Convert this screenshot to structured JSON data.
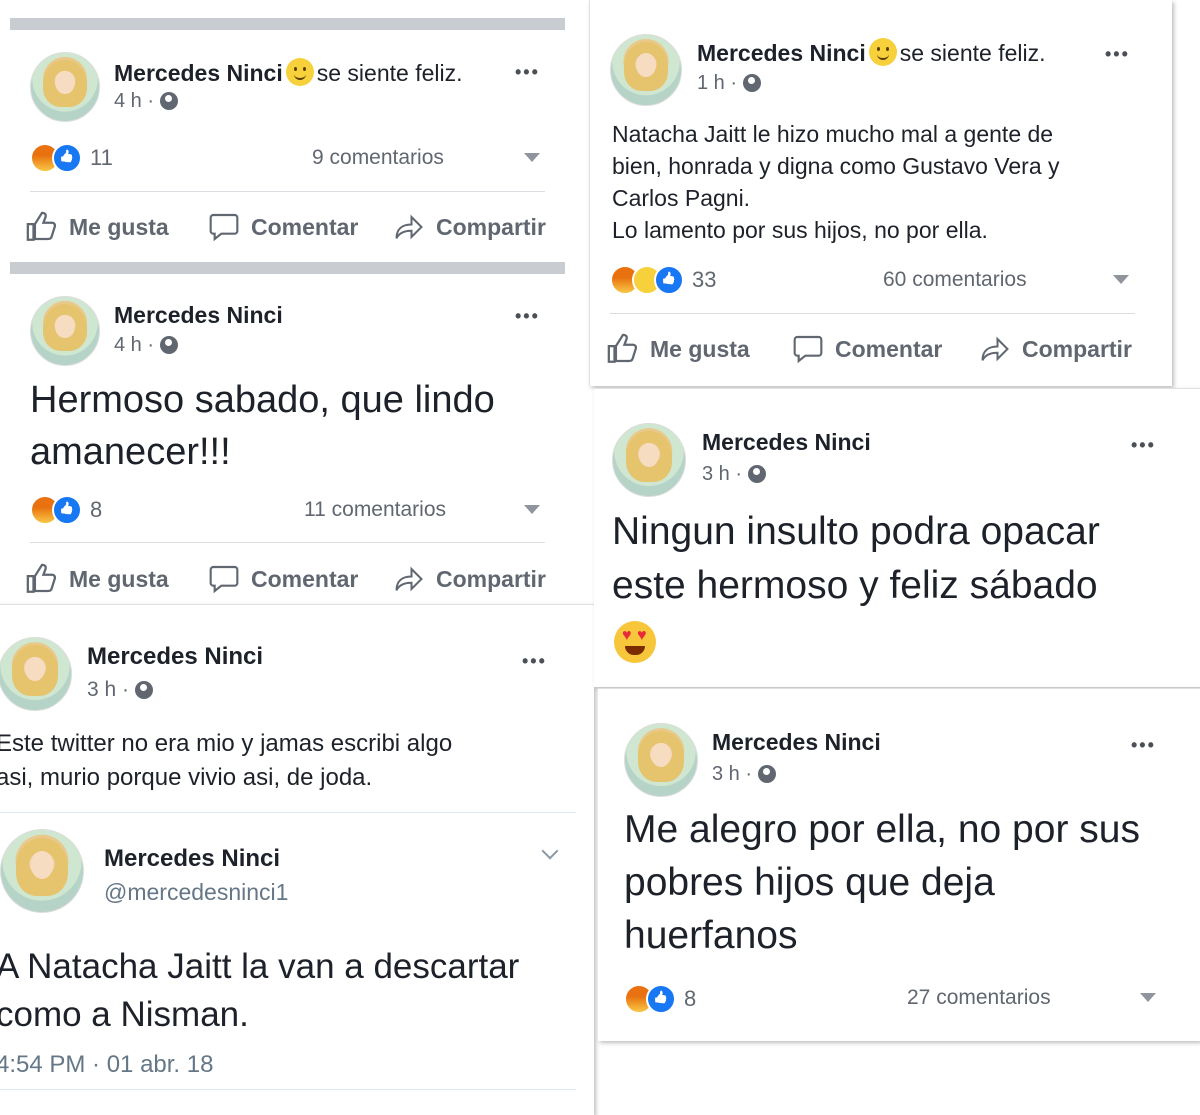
{
  "colors": {
    "accent": "#1877f2",
    "text": "#1d2129",
    "meta": "#616770",
    "divider": "#dadde1",
    "band": "#c9ccd1"
  },
  "posts": [
    {
      "author": "Mercedes Ninci",
      "feeling": "se siente feliz.",
      "time": "4 h",
      "body": "",
      "reactions": "11",
      "comments": "9 comentarios"
    },
    {
      "author": "Mercedes Ninci",
      "time": "4 h",
      "body_line1": "Hermoso sabado, que lindo",
      "body_line2": "amanecer!!!",
      "reactions": "8",
      "comments": "11 comentarios"
    },
    {
      "author": "Mercedes Ninci",
      "time": "3 h",
      "body_line1": "Este twitter no era mio y jamas escribi algo",
      "body_line2": "asi, murio porque vivio asi, de joda."
    },
    {
      "author": "Mercedes Ninci",
      "feeling": "se siente feliz.",
      "time": "1 h",
      "body_line1": "Natacha Jaitt le hizo mucho mal a gente de",
      "body_line2": "bien, honrada y digna como Gustavo Vera y",
      "body_line3": "Carlos Pagni.",
      "body_line4": "Lo lamento por sus hijos, no por ella.",
      "reactions": "33",
      "comments": "60 comentarios"
    },
    {
      "author": "Mercedes Ninci",
      "time": "3 h",
      "body_line1": "Ningun insulto podra opacar",
      "body_line2": "este hermoso y feliz sábado"
    },
    {
      "author": "Mercedes Ninci",
      "time": "3 h",
      "body_line1": "Me alegro por ella, no por sus",
      "body_line2": "pobres hijos que deja",
      "body_line3": "huerfanos",
      "reactions": "8",
      "comments": "27 comentarios"
    }
  ],
  "tweet": {
    "name": "Mercedes Ninci",
    "handle": "@mercedesninci1",
    "text_line1": "A Natacha Jaitt la van a descartar",
    "text_line2": "como a Nisman.",
    "timestamp": "4:54 PM · 01 abr. 18"
  },
  "actions": {
    "like": "Me gusta",
    "comment": "Comentar",
    "share": "Compartir"
  },
  "ui": {
    "more": "•••",
    "dot": "·"
  },
  "icons": [
    "angry-reaction-icon",
    "like-reaction-icon",
    "haha-reaction-icon",
    "globe-icon",
    "thumbs-up-icon",
    "comment-bubble-icon",
    "share-arrow-icon",
    "heart-eyes-emoji-icon",
    "smile-emoji-icon",
    "chevron-down-icon"
  ]
}
